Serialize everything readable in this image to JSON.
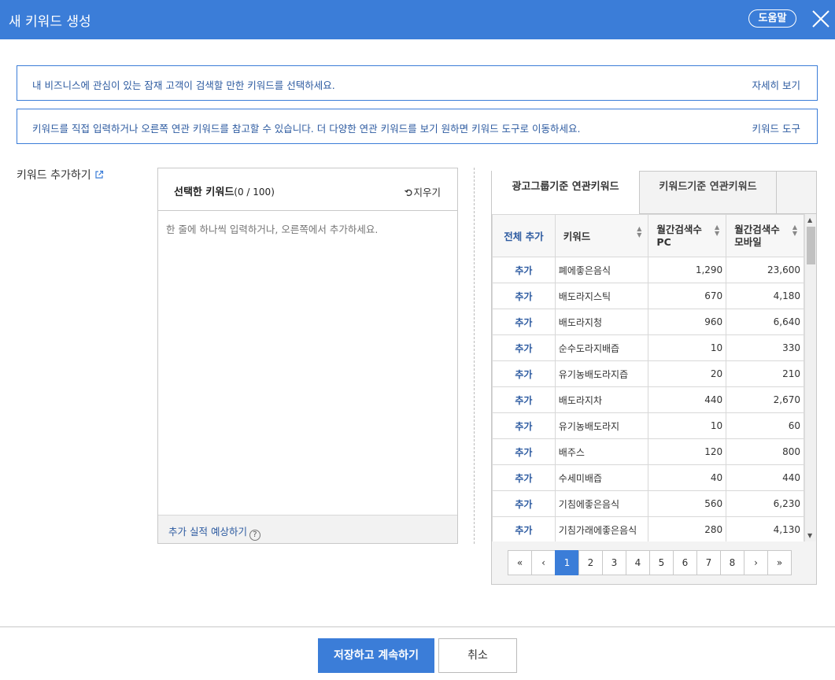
{
  "header": {
    "title": "새 키워드 생성",
    "help_label": "도움말"
  },
  "info": [
    {
      "message": "내 비즈니스에 관심이 있는 잠재 고객이 검색할 만한 키워드를 선택하세요.",
      "link": "자세히 보기"
    },
    {
      "message": "키워드를 직접 입력하거나 오른쪽 연관 키워드를 참고할 수 있습니다. 더 다양한 연관 키워드를 보기 원하면 키워드 도구로 이동하세요.",
      "link": "키워드 도구"
    }
  ],
  "section_label": "키워드 추가하기",
  "selected": {
    "title": "선택한 키워드",
    "count": "(0 / 100)",
    "clear_label": "지우기",
    "placeholder": "한 줄에 하나씩 입력하거나, 오른쪽에서 추가하세요.",
    "forecast_label": "추가 실적 예상하기"
  },
  "related": {
    "tabs": [
      "광고그룹기준 연관키워드",
      "키워드기준 연관키워드"
    ],
    "headers": {
      "add_all": "전체 추가",
      "keyword": "키워드",
      "pc_line1": "월간검색수",
      "pc_line2": "PC",
      "mobile_line1": "월간검색수",
      "mobile_line2": "모바일"
    },
    "add_label": "추가",
    "rows": [
      {
        "keyword": "폐에좋은음식",
        "pc": "1,290",
        "mobile": "23,600"
      },
      {
        "keyword": "배도라지스틱",
        "pc": "670",
        "mobile": "4,180"
      },
      {
        "keyword": "배도라지청",
        "pc": "960",
        "mobile": "6,640"
      },
      {
        "keyword": "순수도라지배즙",
        "pc": "10",
        "mobile": "330"
      },
      {
        "keyword": "유기농배도라지즙",
        "pc": "20",
        "mobile": "210"
      },
      {
        "keyword": "배도라지차",
        "pc": "440",
        "mobile": "2,670"
      },
      {
        "keyword": "유기농배도라지",
        "pc": "10",
        "mobile": "60"
      },
      {
        "keyword": "배주스",
        "pc": "120",
        "mobile": "800"
      },
      {
        "keyword": "수세미배즙",
        "pc": "40",
        "mobile": "440"
      },
      {
        "keyword": "기침에좋은음식",
        "pc": "560",
        "mobile": "6,230"
      },
      {
        "keyword": "기침가래에좋은음식",
        "pc": "280",
        "mobile": "4,130"
      }
    ],
    "pager": {
      "first": "«",
      "prev": "‹",
      "pages": [
        "1",
        "2",
        "3",
        "4",
        "5",
        "6",
        "7",
        "8"
      ],
      "current": "1",
      "next": "›",
      "last": "»"
    }
  },
  "footer": {
    "save_label": "저장하고 계속하기",
    "cancel_label": "취소"
  },
  "colors": {
    "accent": "#3b7dd8",
    "link": "#2c5aa0"
  }
}
